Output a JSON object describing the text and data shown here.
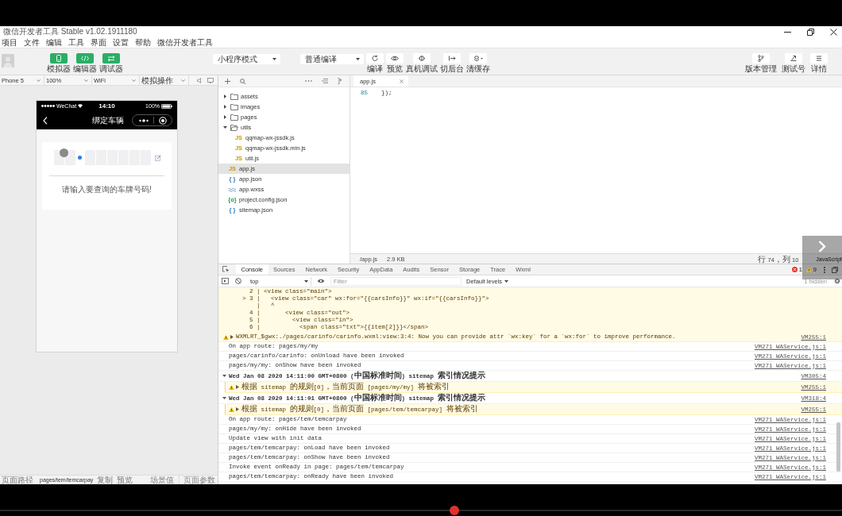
{
  "window": {
    "title": "微信开发者工具 Stable v1.02.1911180"
  },
  "menu": [
    "项目",
    "文件",
    "编辑",
    "工具",
    "界面",
    "设置",
    "帮助",
    "微信开发者工具"
  ],
  "toolbar": {
    "modes": [
      {
        "label": "模拟器",
        "kind": "simulator",
        "selected": true
      },
      {
        "label": "编辑器",
        "kind": "editor",
        "selected": true
      },
      {
        "label": "调试器",
        "kind": "debugger",
        "selected": true
      }
    ],
    "mode_select": "小程序模式",
    "compile_select": "普通编译",
    "actions": [
      {
        "label": "编译",
        "kind": "compile"
      },
      {
        "label": "预览",
        "kind": "preview"
      },
      {
        "label": "真机调试",
        "kind": "remote-debug"
      },
      {
        "label": "切后台",
        "kind": "background"
      },
      {
        "label": "清缓存",
        "kind": "clear-cache",
        "menu": true
      }
    ],
    "right_actions": [
      {
        "label": "版本管理",
        "kind": "version"
      },
      {
        "label": "测试号",
        "kind": "test-account"
      },
      {
        "label": "详情",
        "kind": "details"
      }
    ]
  },
  "simulator": {
    "selects": [
      "Phone 5",
      "100%",
      "WiFi",
      "模拟操作"
    ],
    "phone": {
      "carrier": "WeChat",
      "time": "14:10",
      "battery": "100%",
      "title": "绑定车辆",
      "hint": "请输入要查询的车牌号码!"
    }
  },
  "file_tree": [
    {
      "name": "assets",
      "kind": "folder",
      "expanded": false,
      "selected": false
    },
    {
      "name": "images",
      "kind": "folder",
      "expanded": false,
      "selected": false
    },
    {
      "name": "pages",
      "kind": "folder",
      "expanded": false,
      "selected": false
    },
    {
      "name": "utils",
      "kind": "folder",
      "expanded": true,
      "selected": false,
      "children": [
        {
          "name": "qqmap-wx-jssdk.js",
          "kind": "js",
          "badge": "JS",
          "selected": false
        },
        {
          "name": "qqmap-wx-jssdk.min.js",
          "kind": "js",
          "badge": "JS",
          "selected": false
        },
        {
          "name": "util.js",
          "kind": "js",
          "badge": "JS",
          "selected": false
        }
      ]
    },
    {
      "name": "app.js",
      "kind": "js",
      "badge": "JS",
      "selected": true
    },
    {
      "name": "app.json",
      "kind": "json",
      "badge": "{ }",
      "selected": false
    },
    {
      "name": "app.wxss",
      "kind": "wxss",
      "selected": false
    },
    {
      "name": "project.config.json",
      "kind": "config",
      "badge": "{o}",
      "selected": false
    },
    {
      "name": "sitemap.json",
      "kind": "json",
      "badge": "{ }",
      "selected": false
    }
  ],
  "editor": {
    "tabs": [
      {
        "label": "app.js",
        "selected": true
      }
    ],
    "lines": [
      {
        "number": "85",
        "code": "});"
      }
    ],
    "status": {
      "path": "/app.js",
      "size": "2.9 KB",
      "cursor": "行 74，列 10",
      "language": "JavaScript"
    }
  },
  "devtools": {
    "tabs": [
      {
        "label": "Console",
        "selected": true
      },
      {
        "label": "Sources",
        "selected": false
      },
      {
        "label": "Network",
        "selected": false
      },
      {
        "label": "Security",
        "selected": false
      },
      {
        "label": "AppData",
        "selected": false
      },
      {
        "label": "Audits",
        "selected": false
      },
      {
        "label": "Sensor",
        "selected": false
      },
      {
        "label": "Storage",
        "selected": false
      },
      {
        "label": "Trace",
        "selected": false
      },
      {
        "label": "Wxml",
        "selected": false
      }
    ],
    "errors": "1",
    "warnings": "9",
    "context": "top",
    "filter_placeholder": "Filter",
    "levels": "Default levels",
    "hidden": "1 hidden",
    "messages": [
      {
        "kind": "snippet",
        "lines": [
          "  2 | <view class=\"main\">",
          "> 3 |   <view class=\"car\" wx:for=\"{{carsInfo}}\" wx:if=\"{{carsInfo}}\">",
          "    |   ^",
          "  4 |       <view class=\"out\">",
          "  5 |         <view class=\"in\">",
          "  6 |           <span class=\"txt\">{{item[2]}}</span>"
        ]
      },
      {
        "kind": "warning",
        "expanded": false,
        "text": "WXMLRT_$gwx:./pages/carinfo/carinfo.wxml:view:3:4: Now you can provide attr `wx:key` for a `wx:for` to improve performance.",
        "source": "VM255:1"
      },
      {
        "kind": "log",
        "text": "On app route: pages/my/my",
        "source": "VM271 WAService.js:1"
      },
      {
        "kind": "log",
        "text": "pages/carinfo/carinfo: onUnload have been invoked",
        "source": "VM271 WAService.js:1"
      },
      {
        "kind": "log",
        "text": "pages/my/my: onShow have been invoked",
        "source": "VM271 WAService.js:1"
      },
      {
        "kind": "group",
        "expanded": true,
        "text": "Wed Jan 08 2020 14:11:00 GMT+0800 (中国标准时间) sitemap 索引情况提示",
        "source": "VM305:4",
        "children": [
          {
            "kind": "warning",
            "expanded": false,
            "text": "根据 sitemap 的规则[0]，当前页面 [pages/my/my] 将被索引",
            "source": "VM255:1"
          }
        ]
      },
      {
        "kind": "group",
        "expanded": true,
        "text": "Wed Jan 08 2020 14:11:01 GMT+0800 (中国标准时间) sitemap 索引情况提示",
        "source": "VM318:4",
        "children": [
          {
            "kind": "warning",
            "expanded": false,
            "text": "根据 sitemap 的规则[0]，当前页面 [pages/tem/temcarpay] 将被索引",
            "source": "VM255:1"
          }
        ]
      },
      {
        "kind": "log",
        "text": "On app route: pages/tem/temcarpay",
        "source": "VM271 WAService.js:1"
      },
      {
        "kind": "log",
        "text": "pages/my/my: onHide have been invoked",
        "source": "VM271 WAService.js:1"
      },
      {
        "kind": "log",
        "text": "Update view with init data",
        "source": "VM271 WAService.js:1"
      },
      {
        "kind": "log",
        "text": "pages/tem/temcarpay: onLoad have been invoked",
        "source": "VM271 WAService.js:1"
      },
      {
        "kind": "log",
        "text": "pages/tem/temcarpay: onShow have been invoked",
        "source": "VM271 WAService.js:1"
      },
      {
        "kind": "log",
        "text": "Invoke event onReady in page: pages/tem/temcarpay",
        "source": "VM271 WAService.js:1"
      },
      {
        "kind": "log",
        "text": "pages/tem/temcarpay: onReady have been invoked",
        "source": "VM271 WAService.js:1"
      }
    ]
  },
  "status_bar": {
    "label": "页面路径",
    "path": "pages/tem/temcarpay",
    "links": [
      "复制",
      "预览"
    ],
    "scene": "场景值",
    "params": "页面参数"
  },
  "player": {
    "level": 0.54
  }
}
